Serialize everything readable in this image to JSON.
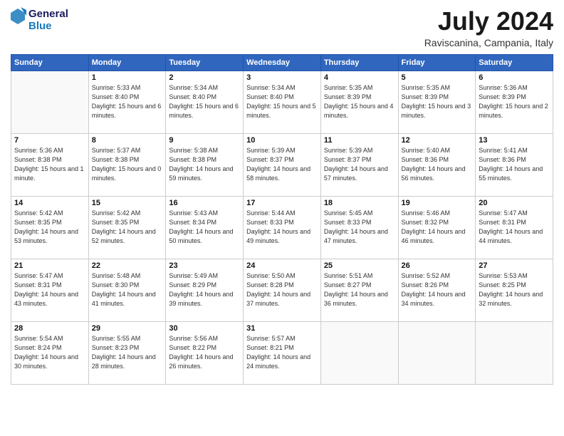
{
  "logo": {
    "line1": "General",
    "line2": "Blue"
  },
  "title": "July 2024",
  "location": "Raviscanina, Campania, Italy",
  "days_header": [
    "Sunday",
    "Monday",
    "Tuesday",
    "Wednesday",
    "Thursday",
    "Friday",
    "Saturday"
  ],
  "weeks": [
    [
      {
        "day": "",
        "info": ""
      },
      {
        "day": "1",
        "info": "Sunrise: 5:33 AM\nSunset: 8:40 PM\nDaylight: 15 hours\nand 6 minutes."
      },
      {
        "day": "2",
        "info": "Sunrise: 5:34 AM\nSunset: 8:40 PM\nDaylight: 15 hours\nand 6 minutes."
      },
      {
        "day": "3",
        "info": "Sunrise: 5:34 AM\nSunset: 8:40 PM\nDaylight: 15 hours\nand 5 minutes."
      },
      {
        "day": "4",
        "info": "Sunrise: 5:35 AM\nSunset: 8:39 PM\nDaylight: 15 hours\nand 4 minutes."
      },
      {
        "day": "5",
        "info": "Sunrise: 5:35 AM\nSunset: 8:39 PM\nDaylight: 15 hours\nand 3 minutes."
      },
      {
        "day": "6",
        "info": "Sunrise: 5:36 AM\nSunset: 8:39 PM\nDaylight: 15 hours\nand 2 minutes."
      }
    ],
    [
      {
        "day": "7",
        "info": "Sunrise: 5:36 AM\nSunset: 8:38 PM\nDaylight: 15 hours\nand 1 minute."
      },
      {
        "day": "8",
        "info": "Sunrise: 5:37 AM\nSunset: 8:38 PM\nDaylight: 15 hours\nand 0 minutes."
      },
      {
        "day": "9",
        "info": "Sunrise: 5:38 AM\nSunset: 8:38 PM\nDaylight: 14 hours\nand 59 minutes."
      },
      {
        "day": "10",
        "info": "Sunrise: 5:39 AM\nSunset: 8:37 PM\nDaylight: 14 hours\nand 58 minutes."
      },
      {
        "day": "11",
        "info": "Sunrise: 5:39 AM\nSunset: 8:37 PM\nDaylight: 14 hours\nand 57 minutes."
      },
      {
        "day": "12",
        "info": "Sunrise: 5:40 AM\nSunset: 8:36 PM\nDaylight: 14 hours\nand 56 minutes."
      },
      {
        "day": "13",
        "info": "Sunrise: 5:41 AM\nSunset: 8:36 PM\nDaylight: 14 hours\nand 55 minutes."
      }
    ],
    [
      {
        "day": "14",
        "info": "Sunrise: 5:42 AM\nSunset: 8:35 PM\nDaylight: 14 hours\nand 53 minutes."
      },
      {
        "day": "15",
        "info": "Sunrise: 5:42 AM\nSunset: 8:35 PM\nDaylight: 14 hours\nand 52 minutes."
      },
      {
        "day": "16",
        "info": "Sunrise: 5:43 AM\nSunset: 8:34 PM\nDaylight: 14 hours\nand 50 minutes."
      },
      {
        "day": "17",
        "info": "Sunrise: 5:44 AM\nSunset: 8:33 PM\nDaylight: 14 hours\nand 49 minutes."
      },
      {
        "day": "18",
        "info": "Sunrise: 5:45 AM\nSunset: 8:33 PM\nDaylight: 14 hours\nand 47 minutes."
      },
      {
        "day": "19",
        "info": "Sunrise: 5:46 AM\nSunset: 8:32 PM\nDaylight: 14 hours\nand 46 minutes."
      },
      {
        "day": "20",
        "info": "Sunrise: 5:47 AM\nSunset: 8:31 PM\nDaylight: 14 hours\nand 44 minutes."
      }
    ],
    [
      {
        "day": "21",
        "info": "Sunrise: 5:47 AM\nSunset: 8:31 PM\nDaylight: 14 hours\nand 43 minutes."
      },
      {
        "day": "22",
        "info": "Sunrise: 5:48 AM\nSunset: 8:30 PM\nDaylight: 14 hours\nand 41 minutes."
      },
      {
        "day": "23",
        "info": "Sunrise: 5:49 AM\nSunset: 8:29 PM\nDaylight: 14 hours\nand 39 minutes."
      },
      {
        "day": "24",
        "info": "Sunrise: 5:50 AM\nSunset: 8:28 PM\nDaylight: 14 hours\nand 37 minutes."
      },
      {
        "day": "25",
        "info": "Sunrise: 5:51 AM\nSunset: 8:27 PM\nDaylight: 14 hours\nand 36 minutes."
      },
      {
        "day": "26",
        "info": "Sunrise: 5:52 AM\nSunset: 8:26 PM\nDaylight: 14 hours\nand 34 minutes."
      },
      {
        "day": "27",
        "info": "Sunrise: 5:53 AM\nSunset: 8:25 PM\nDaylight: 14 hours\nand 32 minutes."
      }
    ],
    [
      {
        "day": "28",
        "info": "Sunrise: 5:54 AM\nSunset: 8:24 PM\nDaylight: 14 hours\nand 30 minutes."
      },
      {
        "day": "29",
        "info": "Sunrise: 5:55 AM\nSunset: 8:23 PM\nDaylight: 14 hours\nand 28 minutes."
      },
      {
        "day": "30",
        "info": "Sunrise: 5:56 AM\nSunset: 8:22 PM\nDaylight: 14 hours\nand 26 minutes."
      },
      {
        "day": "31",
        "info": "Sunrise: 5:57 AM\nSunset: 8:21 PM\nDaylight: 14 hours\nand 24 minutes."
      },
      {
        "day": "",
        "info": ""
      },
      {
        "day": "",
        "info": ""
      },
      {
        "day": "",
        "info": ""
      }
    ]
  ]
}
